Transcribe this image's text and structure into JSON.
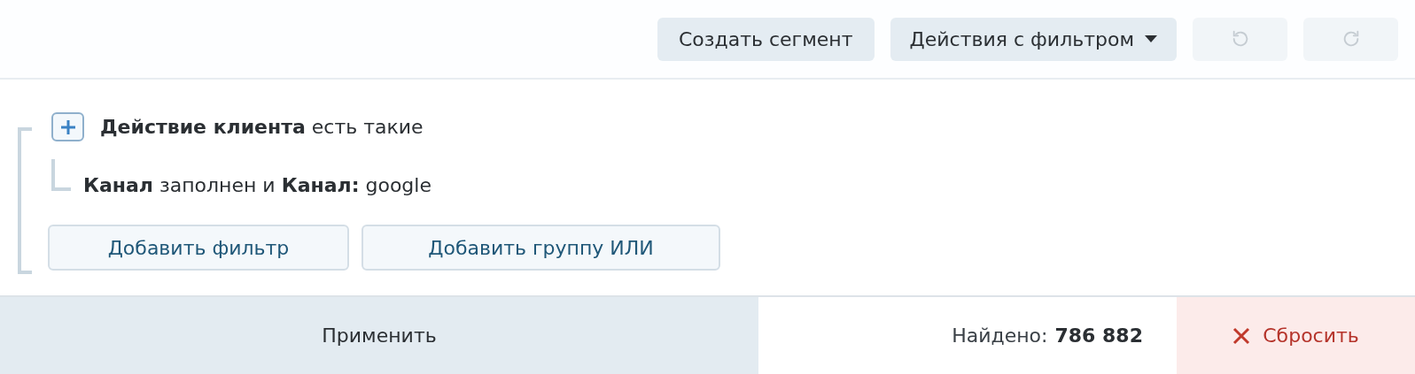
{
  "toolbar": {
    "buttons": [
      {
        "kind": "text",
        "label": "Создать сегмент",
        "disabled": false
      },
      {
        "kind": "dropdown",
        "label": "Действия с фильтром",
        "disabled": false
      },
      {
        "kind": "undo",
        "disabled": true
      },
      {
        "kind": "redo",
        "disabled": true
      }
    ]
  },
  "filter_group": {
    "title": "**Действие клиента** есть такие",
    "children": [
      {
        "text": "**Канал** заполнен и **Канал:** google"
      }
    ],
    "buttons": [
      "Добавить фильтр",
      "Добавить группу ИЛИ"
    ]
  },
  "footer": {
    "apply": "Применить",
    "found_label": "Найдено:",
    "found_count": "786 882",
    "reset": "Сбросить"
  }
}
